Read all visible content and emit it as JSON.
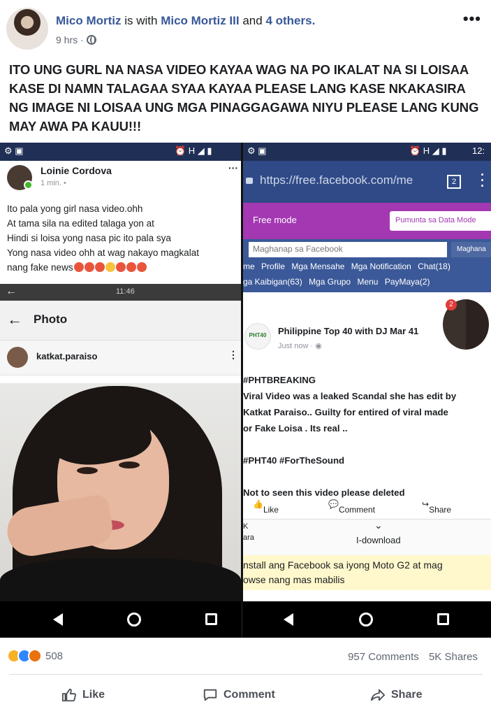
{
  "post": {
    "author": "Mico Mortiz",
    "with_text": "is with",
    "tagged": "Mico Mortiz III",
    "and_text": "and",
    "others": "4 others.",
    "time": "9 hrs ·",
    "caption": "ITO UNG GURL NA NASA VIDEO KAYAA WAG NA PO IKALAT NA SI LOISAA KASE DI NAMN TALAGAA SYAA KAYAA PLEASE LANG KASE NKAKASIRA NG IMAGE NI LOISAA UNG MGA PINAGGAGAWA NIYU PLEASE LANG KUNG MAY AWA PA KAUU!!!",
    "more": "•••"
  },
  "left_shot": {
    "author": "Loinie Cordova",
    "time": "1 min. •",
    "lines": [
      "Ito pala yong girl nasa video.ohh",
      "At tama sila na edited talaga yon at",
      "Hindi si loisa yong nasa pic ito pala sya",
      "Yong nasa video ohh at wag nakayo magkalat",
      "nang fake news"
    ],
    "insta_time": "11:46",
    "photo_title": "Photo",
    "insta_user": "katkat.paraiso"
  },
  "right_shot": {
    "status_time": "12:",
    "url": "https://free.facebook.com/me",
    "tab_count": "2",
    "free_mode": "Free mode",
    "data_mode": "Pumunta sa Data Mode",
    "search_placeholder": "Maghanap sa Facebook",
    "search_btn": "Maghana",
    "links_row1": [
      "me",
      "Profile",
      "Mga Mensahe",
      "Mga Notification",
      "Chat(18)"
    ],
    "links_row2": [
      "ga Kaibigan(63)",
      "Mga Grupo",
      "Menu",
      "PayMaya(2)"
    ],
    "badge": "2",
    "page_name": "Philippine Top 40 with DJ Mar 41",
    "page_logo": "PHT40",
    "page_time": "Just now ·",
    "body": [
      "#PHTBREAKING",
      "Viral Video was a leaked Scandal she has edit by",
      "Katkat Paraiso.. Guilty for entired of viral made",
      "or Fake Loisa . Its real ..",
      "",
      "#PHT40 #ForTheSound",
      "",
      "Not to seen this video please deleted"
    ],
    "like": "Like",
    "comment": "Comment",
    "share": "Share",
    "dl_left_1": "K",
    "dl_left_2": "ara",
    "dl_label": "I-download",
    "install_1": "nstall ang Facebook sa iyong Moto G2 at mag",
    "install_2": "owse nang mas mabilis"
  },
  "footer": {
    "reaction_count": "508",
    "comments": "957 Comments",
    "shares": "5K Shares",
    "like": "Like",
    "comment": "Comment",
    "share": "Share"
  },
  "colors": {
    "fb_blue": "#3b5998",
    "link_blue": "#385898",
    "free_mode_purple": "#a338b2"
  }
}
